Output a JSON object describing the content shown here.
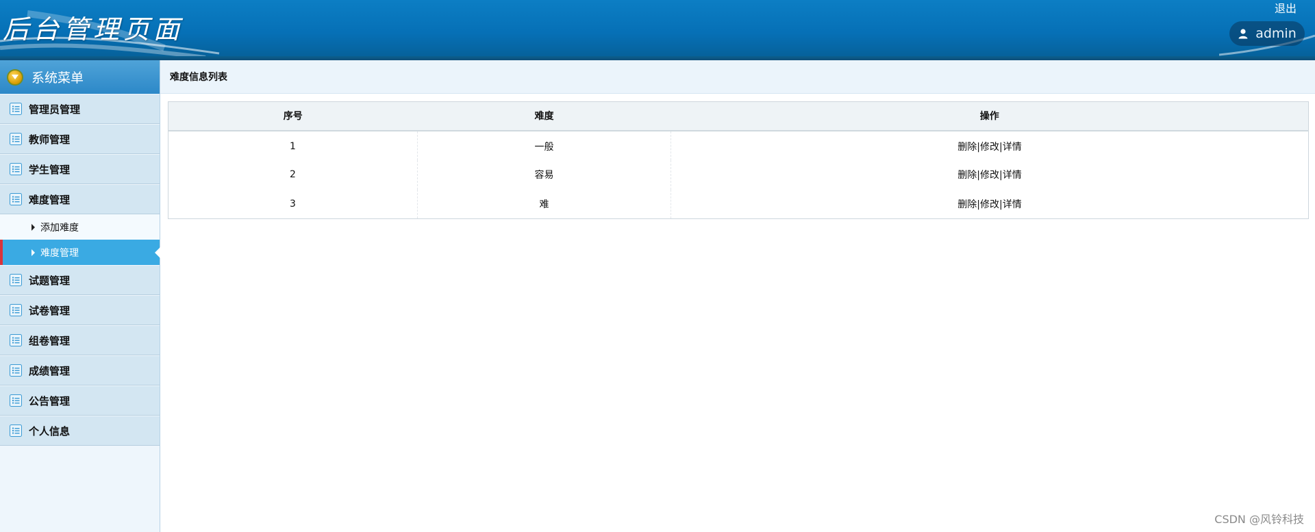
{
  "header": {
    "site_title": "后台管理页面",
    "logout_label": "退出",
    "username": "admin"
  },
  "sidebar": {
    "menu_title": "系统菜单",
    "items": [
      {
        "label": "管理员管理"
      },
      {
        "label": "教师管理"
      },
      {
        "label": "学生管理"
      },
      {
        "label": "难度管理",
        "expanded": true,
        "children": [
          {
            "label": "添加难度"
          },
          {
            "label": "难度管理",
            "active": true
          }
        ]
      },
      {
        "label": "试题管理"
      },
      {
        "label": "试卷管理"
      },
      {
        "label": "组卷管理"
      },
      {
        "label": "成绩管理"
      },
      {
        "label": "公告管理"
      },
      {
        "label": "个人信息"
      }
    ]
  },
  "main": {
    "section_title": "难度信息列表",
    "table": {
      "columns": [
        "序号",
        "难度",
        "操作"
      ],
      "rows": [
        {
          "index": "1",
          "difficulty": "一般"
        },
        {
          "index": "2",
          "difficulty": "容易"
        },
        {
          "index": "3",
          "difficulty": "难"
        }
      ],
      "actions": {
        "delete": "删除",
        "edit": "修改",
        "detail": "详情",
        "separator": "|"
      }
    }
  },
  "watermark": "CSDN @风铃科技",
  "colors": {
    "header_blue": "#0670b6",
    "menu_header": "#2c88c8",
    "active_item": "#3aaae3",
    "active_marker": "#d8343c",
    "menu_item_bg": "#d3e6f2"
  },
  "icons": {
    "menu_toggle": "chevron-down-circle-icon",
    "menu_item": "list-icon",
    "user": "user-icon",
    "sub_item": "triangle-right-icon"
  }
}
